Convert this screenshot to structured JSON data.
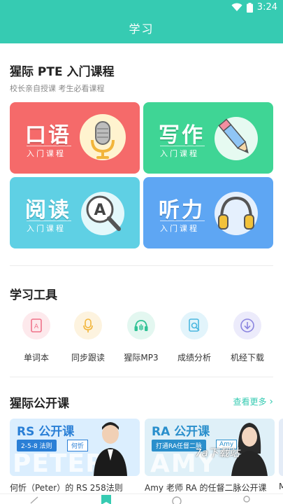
{
  "status": {
    "time": "3:24"
  },
  "appbar": {
    "title": "学习"
  },
  "intro": {
    "title": "猩际 PTE 入门课程",
    "subtitle": "校长亲自授课 考生必看课程",
    "cards": [
      {
        "title": "口语",
        "sub": "入门课程",
        "color": "#f56a6a",
        "icon": "microphone-icon"
      },
      {
        "title": "写作",
        "sub": "入门课程",
        "color": "#3fd595",
        "icon": "pencil-icon"
      },
      {
        "title": "阅读",
        "sub": "入门课程",
        "color": "#5fd0e4",
        "icon": "magnifier-icon",
        "icon_letter": "A"
      },
      {
        "title": "听力",
        "sub": "入门课程",
        "color": "#5ea6f3",
        "icon": "headphones-icon"
      }
    ]
  },
  "tools": {
    "title": "学习工具",
    "items": [
      {
        "label": "单词本",
        "icon": "vocabulary-book-icon",
        "bg": "#fde9ec",
        "color": "#f0728a"
      },
      {
        "label": "同步跟读",
        "icon": "microphone-icon",
        "bg": "#fdf3df",
        "color": "#f2b53a"
      },
      {
        "label": "猩际MP3",
        "icon": "headphones-icon",
        "bg": "#e3f7f0",
        "color": "#30c295"
      },
      {
        "label": "成绩分析",
        "icon": "score-analysis-icon",
        "bg": "#e2f4fb",
        "color": "#4bb7df"
      },
      {
        "label": "机经下载",
        "icon": "download-icon",
        "bg": "#ecebfb",
        "color": "#8c86e0"
      }
    ]
  },
  "open_courses": {
    "title": "猩际公开课",
    "more_label": "查看更多",
    "items": [
      {
        "banner": "RS 公开课",
        "tag": "2-5-8 法则",
        "teacher_tag": "何忻",
        "watermark": "PETER",
        "caption": "何忻（Peter）的 RS 258法则",
        "color": "#3b8fe0",
        "bg": "#dbeefe"
      },
      {
        "banner": "RA 公开课",
        "tag": "打通RA任督二脉",
        "teacher_tag": "Amy",
        "watermark": "AMY",
        "caption": "Amy 老师 RA 的任督二脉公开课",
        "color": "#2d9ad6",
        "bg": "#dff0f8"
      }
    ],
    "third_caption_fragment": "M"
  },
  "overlay": {
    "watermark_text": "7a下载站"
  }
}
